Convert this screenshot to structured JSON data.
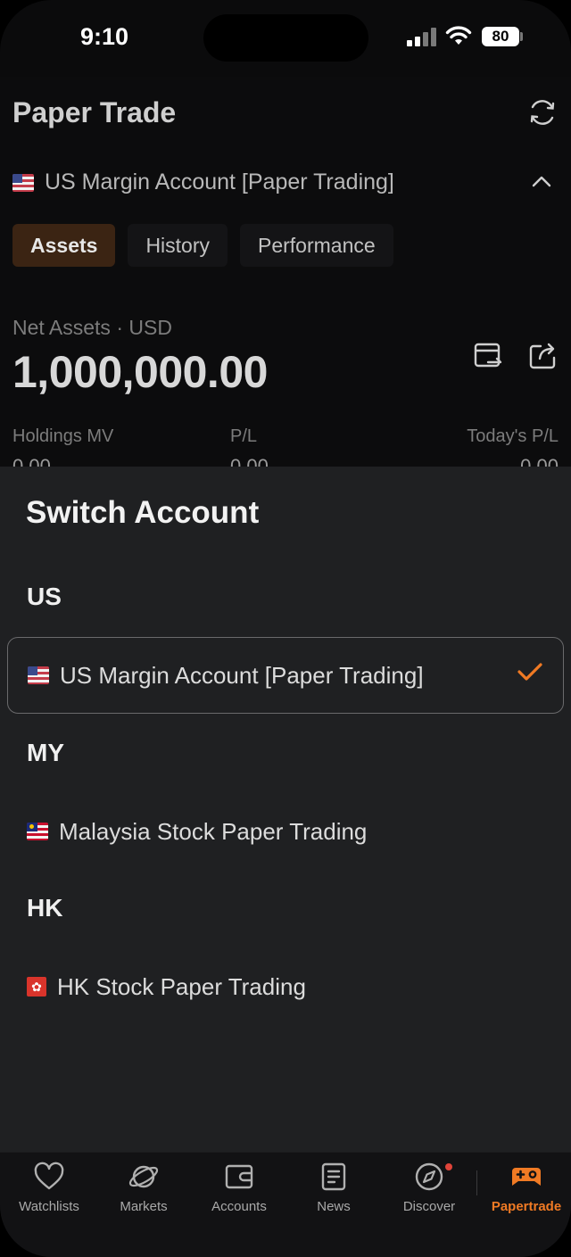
{
  "status_bar": {
    "time": "9:10",
    "battery": "80"
  },
  "header": {
    "title": "Paper Trade"
  },
  "account_selector": {
    "label": "US Margin Account [Paper Trading]"
  },
  "tabs": [
    {
      "label": "Assets",
      "active": true
    },
    {
      "label": "History",
      "active": false
    },
    {
      "label": "Performance",
      "active": false
    }
  ],
  "net_assets": {
    "label": "Net Assets · USD",
    "value": "1,000,000.00"
  },
  "metrics": [
    {
      "label": "Holdings MV",
      "value": "0.00"
    },
    {
      "label": "P/L",
      "value": "0.00"
    },
    {
      "label": "Today's P/L",
      "value": "0.00"
    }
  ],
  "sheet": {
    "title": "Switch Account",
    "sections": [
      {
        "name": "US",
        "accounts": [
          {
            "label": "US Margin Account [Paper Trading]",
            "selected": true,
            "flag": "us-flag-icon"
          }
        ]
      },
      {
        "name": "MY",
        "accounts": [
          {
            "label": "Malaysia Stock Paper Trading",
            "selected": false,
            "flag": "malaysia-flag-icon"
          }
        ]
      },
      {
        "name": "HK",
        "accounts": [
          {
            "label": "HK Stock Paper Trading",
            "selected": false,
            "flag": "hong-kong-flag-icon"
          }
        ]
      }
    ]
  },
  "tab_bar": {
    "items": [
      {
        "label": "Watchlists",
        "icon": "heart-icon"
      },
      {
        "label": "Markets",
        "icon": "planet-icon"
      },
      {
        "label": "Accounts",
        "icon": "wallet-icon"
      },
      {
        "label": "News",
        "icon": "news-icon"
      },
      {
        "label": "Discover",
        "icon": "compass-icon"
      },
      {
        "label": "Papertrade",
        "icon": "gamepad-icon",
        "active": true
      }
    ]
  },
  "colors": {
    "accent": "#f07a24",
    "sheet_bg": "#1f2022",
    "active_tab_bg": "#3b2413"
  }
}
